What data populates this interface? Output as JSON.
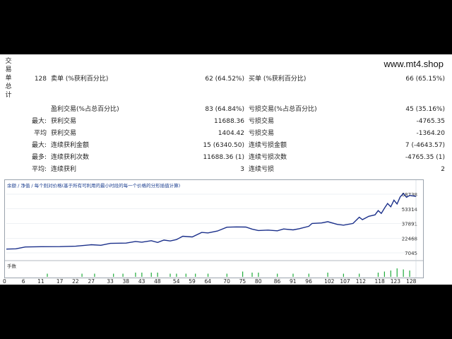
{
  "report": {
    "vertical_title": [
      "交",
      "易",
      "单",
      "总",
      "计"
    ],
    "site": "www.mt4.shop",
    "rows": [
      {
        "c1": "128",
        "c2": "卖单 (%获利百分比)",
        "c3": "62 (64.52%)",
        "c4": "买单 (%获利百分比)",
        "c5": "66 (65.15%)"
      },
      {
        "c1": "",
        "c2": "盈利交易(%占总百分比)",
        "c3": "83 (64.84%)",
        "c4": "亏损交易(%占总百分比)",
        "c5": "45 (35.16%)"
      },
      {
        "c1": "最大:",
        "c2": "获利交易",
        "c3": "11688.36",
        "c4": "亏损交易",
        "c5": "-4765.35"
      },
      {
        "c1": "平均",
        "c2": "获利交易",
        "c3": "1404.42",
        "c4": "亏损交易",
        "c5": "-1364.20"
      },
      {
        "c1": "最大:",
        "c2": "连续获利金额",
        "c3": "15 (6340.50)",
        "c4": "连续亏损金额",
        "c5": "7 (-4643.57)"
      },
      {
        "c1": "最多:",
        "c2": "连续获利次数",
        "c3": "11688.36 (1)",
        "c4": "连续亏损次数",
        "c5": "-4765.35 (1)"
      },
      {
        "c1": "平均:",
        "c2": "连续获利",
        "c3": "3",
        "c4": "连续亏损",
        "c5": "2"
      }
    ]
  },
  "chart": {
    "title": "余额 / 净值 / 每个则对价格(基于所有可利用的最小时段的每一个价格的分形插值计算)",
    "volume_label": "手数",
    "line_color": "#1a2f8a",
    "volume_color": "#1faa3a"
  },
  "chart_data": {
    "type": "line",
    "y_ticks": [
      7045,
      22468,
      37891,
      53314,
      68738
    ],
    "ylim": [
      7045,
      68738
    ],
    "x_ticks": [
      0,
      6,
      11,
      17,
      22,
      27,
      33,
      38,
      43,
      48,
      54,
      59,
      64,
      70,
      75,
      80,
      86,
      91,
      96,
      102,
      107,
      112,
      118,
      123,
      128
    ],
    "xlim": [
      0,
      130
    ],
    "series": [
      {
        "values": [
          {
            "x": 0,
            "y": 11000
          },
          {
            "x": 3,
            "y": 11300
          },
          {
            "x": 6,
            "y": 13200
          },
          {
            "x": 11,
            "y": 13500
          },
          {
            "x": 17,
            "y": 13600
          },
          {
            "x": 22,
            "y": 14000
          },
          {
            "x": 27,
            "y": 15600
          },
          {
            "x": 30,
            "y": 15000
          },
          {
            "x": 33,
            "y": 17000
          },
          {
            "x": 38,
            "y": 17300
          },
          {
            "x": 41,
            "y": 19000
          },
          {
            "x": 43,
            "y": 18300
          },
          {
            "x": 46,
            "y": 19800
          },
          {
            "x": 48,
            "y": 18000
          },
          {
            "x": 50,
            "y": 20500
          },
          {
            "x": 52,
            "y": 19500
          },
          {
            "x": 54,
            "y": 21000
          },
          {
            "x": 56,
            "y": 24500
          },
          {
            "x": 59,
            "y": 23800
          },
          {
            "x": 62,
            "y": 28500
          },
          {
            "x": 64,
            "y": 28000
          },
          {
            "x": 67,
            "y": 30000
          },
          {
            "x": 70,
            "y": 34000
          },
          {
            "x": 73,
            "y": 34300
          },
          {
            "x": 76,
            "y": 34200
          },
          {
            "x": 78,
            "y": 32000
          },
          {
            "x": 80,
            "y": 30500
          },
          {
            "x": 83,
            "y": 31000
          },
          {
            "x": 86,
            "y": 30200
          },
          {
            "x": 88,
            "y": 32200
          },
          {
            "x": 91,
            "y": 31200
          },
          {
            "x": 93,
            "y": 32500
          },
          {
            "x": 96,
            "y": 35000
          },
          {
            "x": 97,
            "y": 38000
          },
          {
            "x": 100,
            "y": 38500
          },
          {
            "x": 102,
            "y": 39800
          },
          {
            "x": 105,
            "y": 37000
          },
          {
            "x": 107,
            "y": 36200
          },
          {
            "x": 110,
            "y": 38000
          },
          {
            "x": 112,
            "y": 44500
          },
          {
            "x": 113,
            "y": 42000
          },
          {
            "x": 115,
            "y": 45500
          },
          {
            "x": 117,
            "y": 47000
          },
          {
            "x": 118,
            "y": 51500
          },
          {
            "x": 119,
            "y": 48500
          },
          {
            "x": 120,
            "y": 54000
          },
          {
            "x": 121,
            "y": 59000
          },
          {
            "x": 122,
            "y": 55500
          },
          {
            "x": 123,
            "y": 62500
          },
          {
            "x": 124,
            "y": 58500
          },
          {
            "x": 125,
            "y": 66000
          },
          {
            "x": 126,
            "y": 69500
          },
          {
            "x": 127,
            "y": 65500
          },
          {
            "x": 128,
            "y": 67500
          },
          {
            "x": 130,
            "y": 66500
          }
        ]
      }
    ],
    "volume_bars_x": [
      13,
      24,
      28,
      34,
      37,
      41,
      43,
      46,
      48,
      52,
      54,
      57,
      60,
      64,
      70,
      75,
      78,
      80,
      86,
      91,
      96,
      102,
      107,
      112,
      118,
      120,
      122,
      124,
      126,
      128
    ],
    "volume_bars_level": [
      0.3,
      0.3,
      0.3,
      0.3,
      0.3,
      0.4,
      0.4,
      0.4,
      0.4,
      0.3,
      0.3,
      0.3,
      0.3,
      0.3,
      0.3,
      0.5,
      0.4,
      0.4,
      0.3,
      0.3,
      0.3,
      0.4,
      0.3,
      0.3,
      0.4,
      0.5,
      0.6,
      0.8,
      0.7,
      0.6
    ]
  }
}
